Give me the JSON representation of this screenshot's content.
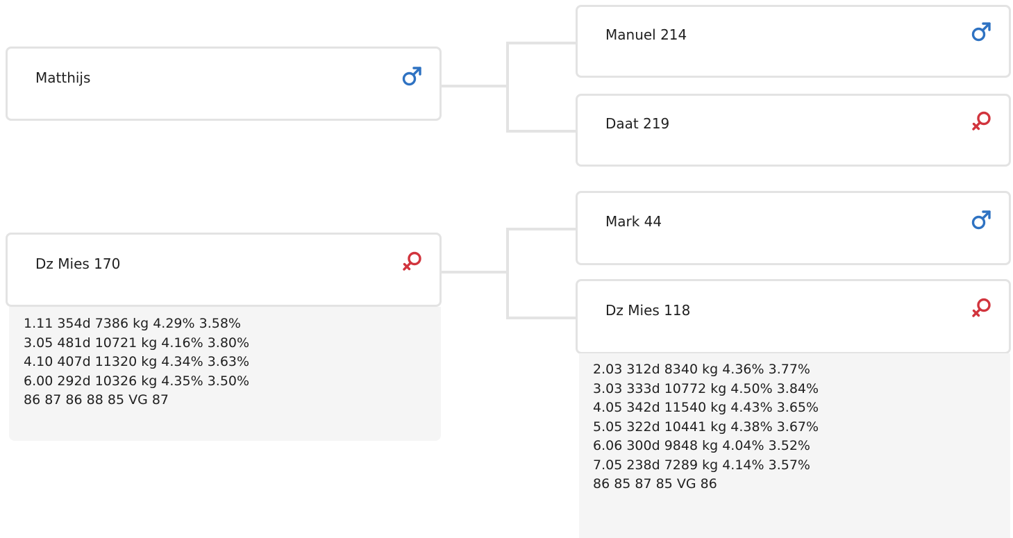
{
  "colors": {
    "male": "#2e72c2",
    "female": "#d1343d",
    "border": "#e3e3e3",
    "stats_bg": "#f5f5f5"
  },
  "animals": {
    "parent_sire": {
      "name": "Matthijs",
      "sex": "male-icon"
    },
    "parent_dam": {
      "name": "Dz Mies 170",
      "sex": "female-icon",
      "stats": [
        "1.11 354d 7386 kg 4.29% 3.58%",
        "3.05 481d 10721 kg 4.16% 3.80%",
        "4.10 407d 11320 kg 4.34% 3.63%",
        "6.00 292d 10326 kg 4.35% 3.50%",
        "86 87 86 88 85 VG 87"
      ]
    },
    "sire_sire": {
      "name": "Manuel 214",
      "sex": "male-icon"
    },
    "sire_dam": {
      "name": "Daat 219",
      "sex": "female-icon"
    },
    "dam_sire": {
      "name": "Mark 44",
      "sex": "male-icon"
    },
    "dam_dam": {
      "name": "Dz Mies 118",
      "sex": "female-icon",
      "stats": [
        "2.03 312d 8340 kg 4.36% 3.77%",
        "3.03 333d 10772 kg 4.50% 3.84%",
        "4.05 342d 11540 kg 4.43% 3.65%",
        "5.05 322d 10441 kg 4.38% 3.67%",
        "6.06 300d 9848 kg 4.04% 3.52%",
        "7.05 238d 7289 kg 4.14% 3.57%",
        "86 85 87 85 VG 86"
      ]
    }
  }
}
